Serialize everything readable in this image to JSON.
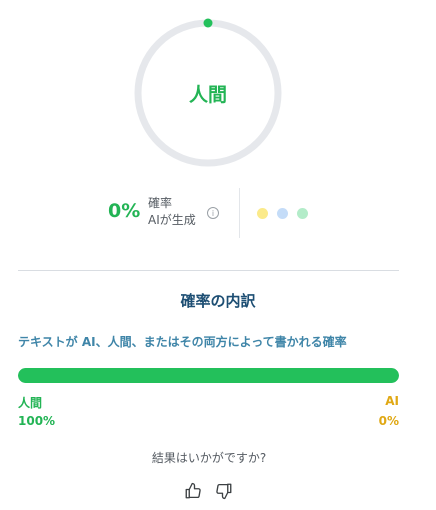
{
  "gauge": {
    "label": "人間",
    "ai_fraction": 0.0,
    "track_color": "#e6e8ec",
    "indicator_color": "#23c05b"
  },
  "stats": {
    "percent": "0%",
    "desc_line1": "確率",
    "desc_line2": "AIが生成",
    "info_icon": "info-icon",
    "dots": [
      {
        "name": "yellow-dot",
        "color": "#fbea8a"
      },
      {
        "name": "blue-dot",
        "color": "#c4dcf8"
      },
      {
        "name": "green-dot",
        "color": "#b3ecc9"
      }
    ]
  },
  "breakdown": {
    "title": "確率の内訳",
    "subtitle": "テキストが AI、人間、またはその両方によって書かれる確率",
    "human_fraction": 1.0,
    "human_label": "人間",
    "human_value": "100%",
    "ai_label": "AI",
    "ai_value": "0%"
  },
  "feedback": {
    "question": "結果はいかがですか?",
    "up_icon": "thumbs-up-icon",
    "down_icon": "thumbs-down-icon"
  }
}
